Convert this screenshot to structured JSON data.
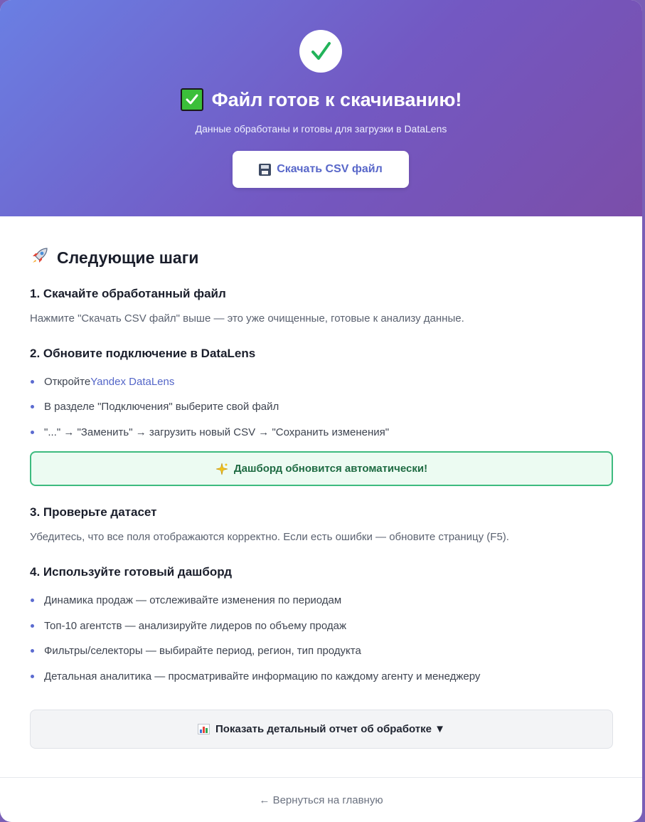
{
  "hero": {
    "title": "Файл готов к скачиванию!",
    "subtitle": "Данные обработаны и готовы для загрузки в DataLens",
    "download_label": "Скачать CSV файл",
    "icons": [
      "check-circle-icon",
      "check-box-icon",
      "floppy-disk-icon"
    ]
  },
  "steps": {
    "heading": "Следующие шаги",
    "step1": {
      "title": "1. Скачайте обработанный файл",
      "text": "Нажмите \"Скачать CSV файл\" выше — это уже очищенные, готовые к анализу данные."
    },
    "step2": {
      "title": "2. Обновите подключение в DataLens",
      "b1_prefix": "Откройте ",
      "b1_link": "Yandex DataLens",
      "b2": "В разделе \"Подключения\" выберите свой файл",
      "b3": "\"...\" → \"Заменить\" → загрузить новый CSV → \"Сохранить изменения\"",
      "notice": "Дашборд обновится автоматически!"
    },
    "step3": {
      "title": "3. Проверьте датасет",
      "text": "Убедитесь, что все поля отображаются корректно. Если есть ошибки — обновите страницу (F5)."
    },
    "step4": {
      "title": "4. Используйте готовый дашборд",
      "items": [
        "Динамика продаж — отслеживайте изменения по периодам",
        "Топ-10 агентств — анализируйте лидеров по объему продаж",
        "Фильтры/селекторы — выбирайте период, регион, тип продукта",
        "Детальная аналитика — просматривайте информацию по каждому агенту и менеджеру"
      ]
    }
  },
  "report_button": "Показать детальный отчет об обработке ▼",
  "footer": {
    "back_label": "← Вернуться на главную"
  },
  "colors": {
    "gradient_start": "#6a7fe3",
    "gradient_end": "#7b4ea9",
    "accent": "#5466c8",
    "success": "#3dbb7f"
  }
}
